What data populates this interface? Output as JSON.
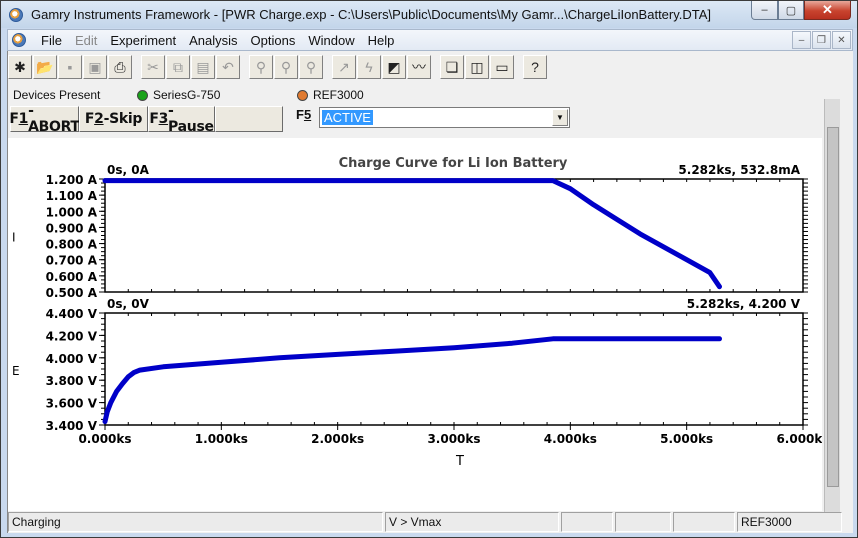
{
  "window": {
    "title": "Gamry Instruments Framework - [PWR Charge.exp - C:\\Users\\Public\\Documents\\My Gamr...\\ChargeLiIonBattery.DTA]",
    "controls": {
      "minimize": "–",
      "maximize": "▢",
      "close": "✕"
    }
  },
  "menubar": {
    "items": [
      {
        "label": "File",
        "enabled": true
      },
      {
        "label": "Edit",
        "enabled": false
      },
      {
        "label": "Experiment",
        "enabled": true
      },
      {
        "label": "Analysis",
        "enabled": true
      },
      {
        "label": "Options",
        "enabled": true
      },
      {
        "label": "Window",
        "enabled": true
      },
      {
        "label": "Help",
        "enabled": true
      }
    ],
    "mdi_controls": {
      "minimize": "–",
      "restore": "❐",
      "close": "✕"
    }
  },
  "toolbar": {
    "buttons": [
      {
        "icon": "new-file-icon",
        "glyph": "✱",
        "enabled": true
      },
      {
        "icon": "open-folder-icon",
        "glyph": "📂",
        "enabled": true
      },
      {
        "icon": "save-icon",
        "glyph": "▪",
        "enabled": false
      },
      {
        "icon": "save-all-icon",
        "glyph": "▣",
        "enabled": false
      },
      {
        "icon": "print-icon",
        "glyph": "⎙",
        "enabled": true
      },
      {
        "sep": true
      },
      {
        "icon": "cut-icon",
        "glyph": "✂",
        "enabled": false
      },
      {
        "icon": "copy-icon",
        "glyph": "⧉",
        "enabled": false
      },
      {
        "icon": "paste-icon",
        "glyph": "▤",
        "enabled": false
      },
      {
        "icon": "undo-icon",
        "glyph": "↶",
        "enabled": false
      },
      {
        "sep": true
      },
      {
        "icon": "probe-query-icon",
        "glyph": "⚲",
        "enabled": false
      },
      {
        "icon": "probe-add-icon",
        "glyph": "⚲",
        "enabled": false
      },
      {
        "icon": "probe-remove-icon",
        "glyph": "⚲",
        "enabled": false
      },
      {
        "sep": true
      },
      {
        "icon": "cursor-tool-icon",
        "glyph": "↗",
        "enabled": false
      },
      {
        "icon": "lightning-icon",
        "glyph": "ϟ",
        "enabled": false
      },
      {
        "icon": "analysis-icon",
        "glyph": "◩",
        "enabled": true
      },
      {
        "icon": "chart-icon",
        "glyph": "〰",
        "enabled": true
      },
      {
        "sep": true
      },
      {
        "icon": "cascade-windows-icon",
        "glyph": "❏",
        "enabled": true
      },
      {
        "icon": "tile-windows-icon",
        "glyph": "◫",
        "enabled": true
      },
      {
        "icon": "arrange-windows-icon",
        "glyph": "▭",
        "enabled": true
      },
      {
        "sep": true
      },
      {
        "icon": "help-icon",
        "glyph": "?",
        "enabled": true
      }
    ]
  },
  "devices": {
    "label": "Devices Present",
    "items": [
      {
        "name": "SeriesG-750",
        "color": "#1aa31a"
      },
      {
        "name": "REF3000",
        "color": "#e07a30"
      }
    ]
  },
  "fkeys": [
    {
      "pre": "F",
      "ul": "1",
      "post": "-ABORT"
    },
    {
      "pre": "F",
      "ul": "2",
      "post": "-Skip"
    },
    {
      "pre": "F",
      "ul": "3",
      "post": "-Pause"
    },
    {
      "pre": "",
      "ul": "",
      "post": ""
    }
  ],
  "f5": {
    "pre": "F",
    "ul": "5",
    "value": "ACTIVE",
    "arrow": "▼"
  },
  "chart_data": [
    {
      "type": "line",
      "title": "Charge Curve for Li Ion Battery",
      "ylabel": "I",
      "xlabel": "",
      "x_unit": "ks",
      "xlim": [
        0,
        6.0
      ],
      "ylim": [
        0.5,
        1.2
      ],
      "yticks": [
        "0.500 A",
        "0.600 A",
        "0.700 A",
        "0.800 A",
        "0.900 A",
        "1.000 A",
        "1.100 A",
        "1.200 A"
      ],
      "ytick_values": [
        0.5,
        0.6,
        0.7,
        0.8,
        0.9,
        1.0,
        1.1,
        1.2
      ],
      "corner_label_left": "0s, 0A",
      "corner_label_right": "5.282ks, 532.8mA",
      "color": "#0000c8",
      "series": [
        {
          "name": "I",
          "x": [
            0,
            0.5,
            1.0,
            1.5,
            2.0,
            2.5,
            3.0,
            3.5,
            3.85,
            4.0,
            4.2,
            4.4,
            4.6,
            4.8,
            5.0,
            5.2,
            5.282
          ],
          "y": [
            1.19,
            1.19,
            1.19,
            1.19,
            1.19,
            1.19,
            1.19,
            1.19,
            1.19,
            1.14,
            1.04,
            0.95,
            0.86,
            0.78,
            0.7,
            0.62,
            0.533
          ]
        }
      ]
    },
    {
      "type": "line",
      "ylabel": "E",
      "xlabel": "T",
      "x_unit": "ks",
      "xlim": [
        0,
        6.0
      ],
      "ylim": [
        3.4,
        4.4
      ],
      "xticks": [
        "0.000ks",
        "1.000ks",
        "2.000ks",
        "3.000ks",
        "4.000ks",
        "5.000ks",
        "6.000ks"
      ],
      "xtick_values": [
        0,
        1,
        2,
        3,
        4,
        5,
        6
      ],
      "yticks": [
        "3.400 V",
        "3.600 V",
        "3.800 V",
        "4.000 V",
        "4.200 V",
        "4.400 V"
      ],
      "ytick_values": [
        3.4,
        3.6,
        3.8,
        4.0,
        4.2,
        4.4
      ],
      "corner_label_left": "0s, 0V",
      "corner_label_right": "5.282ks, 4.200 V",
      "color": "#0000c8",
      "series": [
        {
          "name": "E",
          "x": [
            0,
            0.02,
            0.05,
            0.1,
            0.15,
            0.2,
            0.25,
            0.3,
            0.5,
            1.0,
            1.5,
            2.0,
            2.5,
            3.0,
            3.5,
            3.85,
            4.0,
            4.5,
            5.0,
            5.282
          ],
          "y": [
            3.43,
            3.52,
            3.6,
            3.7,
            3.77,
            3.83,
            3.87,
            3.89,
            3.92,
            3.96,
            4.0,
            4.03,
            4.06,
            4.09,
            4.13,
            4.17,
            4.17,
            4.17,
            4.17,
            4.17
          ]
        }
      ]
    }
  ],
  "statusbar": {
    "cells": [
      "Charging",
      "V > Vmax",
      "",
      "",
      "",
      "REF3000"
    ]
  }
}
